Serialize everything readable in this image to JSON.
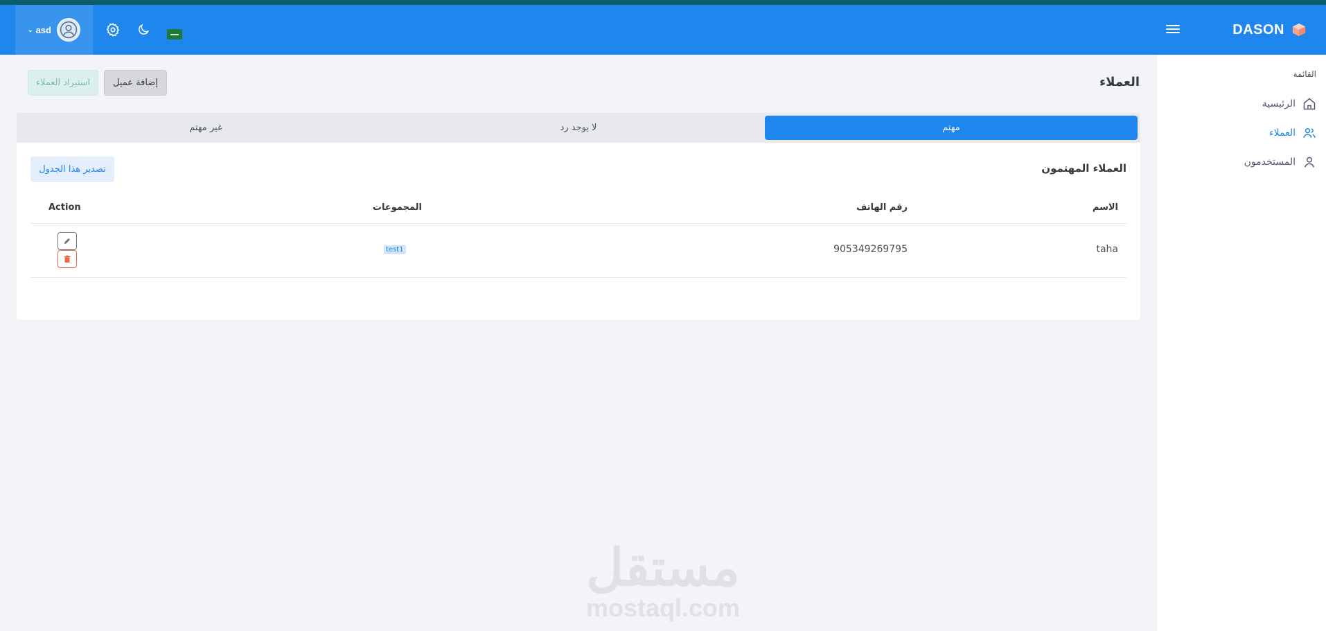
{
  "brand": {
    "name": "DASON"
  },
  "header": {
    "user_name": "asd",
    "icons": {
      "settings": "gear-icon",
      "theme": "moon-icon",
      "language": "flag-icon",
      "menu": "menu-icon"
    }
  },
  "sidebar": {
    "title": "القائمة",
    "items": [
      {
        "label": "الرئيسية",
        "icon": "home-icon"
      },
      {
        "label": "العملاء",
        "icon": "users-icon",
        "active": true
      },
      {
        "label": "المستخدمون",
        "icon": "user-icon"
      }
    ]
  },
  "page": {
    "title": "العملاء",
    "add_button": "إضافة عميل",
    "import_button": "استيراد العملاء"
  },
  "tabs": [
    {
      "label": "مهتم",
      "active": true
    },
    {
      "label": "لا يوجد رد"
    },
    {
      "label": "غير مهتم"
    }
  ],
  "table_card": {
    "title": "العملاء المهتمون",
    "export_button": "تصدير هذا الجدول",
    "columns": [
      "الاسم",
      "رقم الهاتف",
      "المجموعات",
      "Action"
    ],
    "rows": [
      {
        "name": "taha",
        "phone": "905349269795",
        "group": "test1"
      }
    ]
  },
  "watermark": {
    "arabic": "مستقل",
    "latin": "mostaql.com"
  },
  "colors": {
    "primary": "#1e86ec",
    "danger": "#f06548",
    "background": "#f3f4f8"
  }
}
